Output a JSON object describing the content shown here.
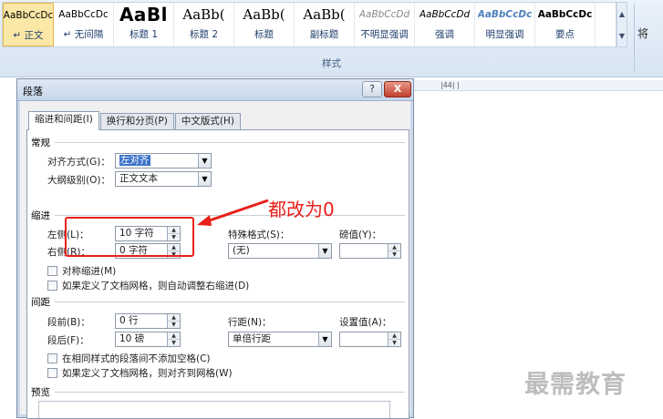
{
  "ribbon": {
    "styles": [
      {
        "preview": "AaBbCcDc",
        "name": "↵ 正文",
        "cls": "pv-normal"
      },
      {
        "preview": "AaBbCcDc",
        "name": "↵ 无间隔",
        "cls": "pv-normal"
      },
      {
        "preview": "AaBl",
        "name": "标题 1",
        "cls": "pv-heading1"
      },
      {
        "preview": "AaBb(",
        "name": "标题 2",
        "cls": "pv-heading2"
      },
      {
        "preview": "AaBb(",
        "name": "标题",
        "cls": "pv-title"
      },
      {
        "preview": "AaBb(",
        "name": "副标题",
        "cls": "pv-title"
      },
      {
        "preview": "AaBbCcDd",
        "name": "不明显强调",
        "cls": "pv-subtle"
      },
      {
        "preview": "AaBbCcDd",
        "name": "强调",
        "cls": "pv-emph"
      },
      {
        "preview": "AaBbCcDc",
        "name": "明显强调",
        "cls": "pv-intense"
      },
      {
        "preview": "AaBbCcDc",
        "name": "要点",
        "cls": "pv-strong"
      }
    ],
    "group_label": "样式",
    "edge_char": "将"
  },
  "ruler": {
    "text": "|44|  |"
  },
  "dialog": {
    "title": "段落",
    "help_label": "?",
    "close_label": "X",
    "tabs": [
      "缩进和间距(I)",
      "换行和分页(P)",
      "中文版式(H)"
    ],
    "general": {
      "title": "常规",
      "alignment_label": "对齐方式(G)：",
      "alignment_value": "左对齐",
      "outline_label": "大纲级别(O)：",
      "outline_value": "正文文本"
    },
    "indent": {
      "title": "缩进",
      "left_label": "左侧(L)：",
      "left_value": "10 字符",
      "right_label": "右侧(R)：",
      "right_value": "0 字符",
      "special_label": "特殊格式(S)：",
      "special_value": "(无)",
      "by_label": "磅值(Y)：",
      "by_value": "",
      "mirror_label": "对称缩进(M)",
      "auto_adjust_label": "如果定义了文档网格，则自动调整右缩进(D)"
    },
    "spacing": {
      "title": "间距",
      "before_label": "段前(B)：",
      "before_value": "0 行",
      "after_label": "段后(F)：",
      "after_value": "10 磅",
      "line_label": "行距(N)：",
      "line_value": "单倍行距",
      "at_label": "设置值(A)：",
      "at_value": "",
      "no_space_label": "在相同样式的段落间不添加空格(C)",
      "snap_grid_label": "如果定义了文档网格，则对齐到网格(W)"
    },
    "preview": {
      "title": "预览"
    }
  },
  "annotation": {
    "text": "都改为0",
    "color": "#e8201a"
  },
  "watermark": {
    "text": "最需教育"
  }
}
